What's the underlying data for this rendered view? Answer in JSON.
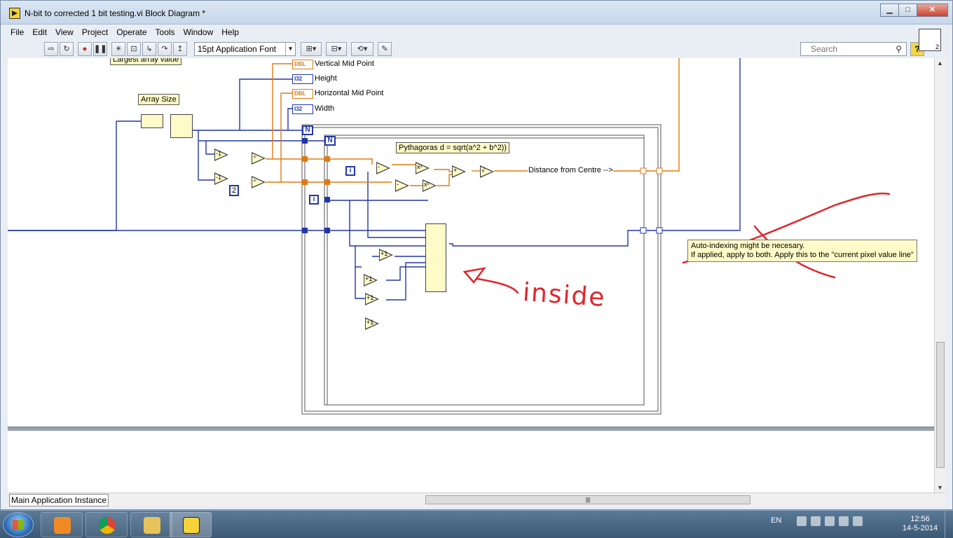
{
  "window": {
    "title": "N-bit to corrected 1 bit testing.vi Block Diagram *",
    "controls": {
      "minimize": "▁",
      "maximize": "□",
      "close": "✕"
    }
  },
  "menu": [
    "File",
    "Edit",
    "View",
    "Project",
    "Operate",
    "Tools",
    "Window",
    "Help"
  ],
  "toolbar": {
    "font": "15pt Application Font",
    "search_placeholder": "Search",
    "help": "?",
    "vi_icon_badge": "2"
  },
  "diagram": {
    "labels": {
      "largest": "Largest array value",
      "array_size": "Array Size",
      "pythagoras": "Pythagoras d = sqrt(a^2 + b^2))",
      "distance": "Distance from Centre -->"
    },
    "terminals": [
      {
        "type": "DBL",
        "label": "Vertical Mid Point"
      },
      {
        "type": "I32",
        "label": "Height"
      },
      {
        "type": "DBL",
        "label": "Horizontal Mid Point"
      },
      {
        "type": "I32",
        "label": "Width"
      }
    ],
    "constants": {
      "two": "2"
    },
    "loop_symbols": {
      "count": "N",
      "iter": "i"
    },
    "nodes": {
      "minus_one": "-1",
      "plus_one": "+1",
      "divide": "÷",
      "subtract": "-",
      "square": "x²",
      "add": "+",
      "sqrt": "√"
    },
    "note": {
      "line1": "Auto-indexing might be necesary.",
      "line2": "If applied, apply to both. Apply this to the \"current pixel value line\""
    },
    "annotation": "inside"
  },
  "status": {
    "instance": "Main Application Instance"
  },
  "taskbar": {
    "language": "EN",
    "time": "12:56",
    "date": "14-5-2014"
  }
}
